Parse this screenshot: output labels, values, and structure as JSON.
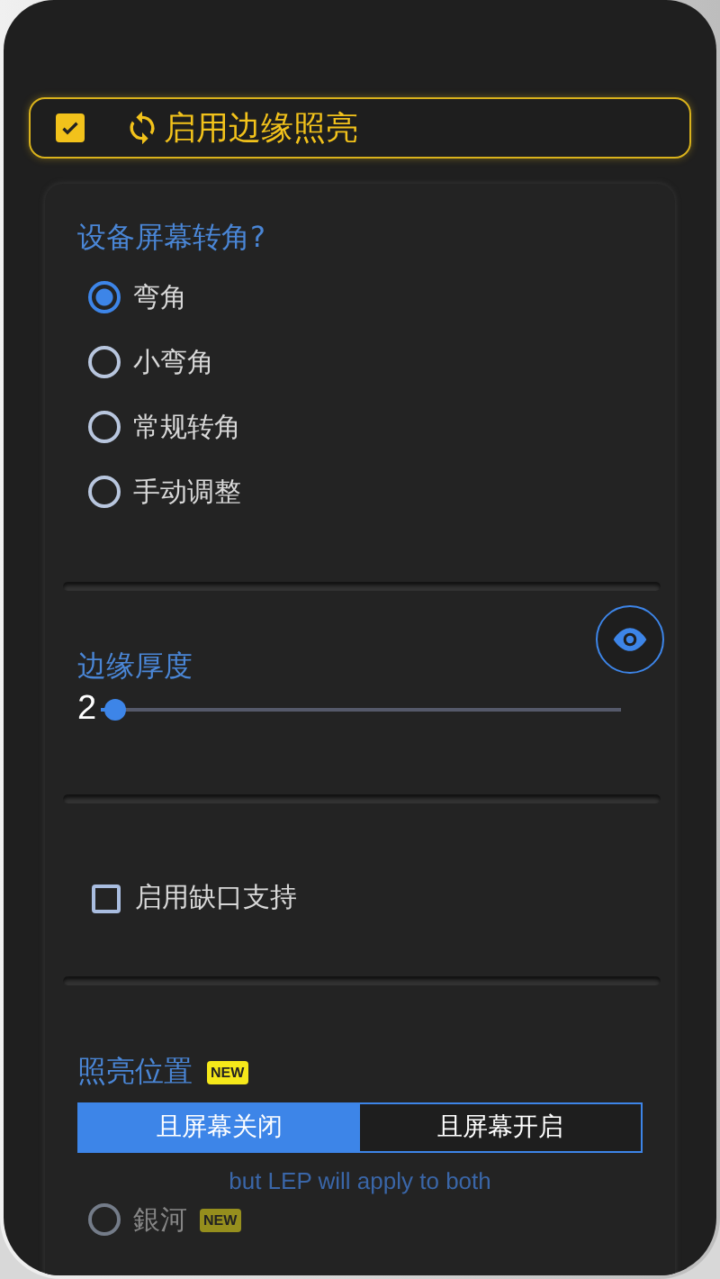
{
  "enable_toggle": {
    "label": "启用边缘照亮",
    "checked": true
  },
  "corner_section": {
    "title": "设备屏幕转角?",
    "options": [
      {
        "label": "弯角",
        "selected": true
      },
      {
        "label": "小弯角",
        "selected": false
      },
      {
        "label": "常规转角",
        "selected": false
      },
      {
        "label": "手动调整",
        "selected": false
      }
    ]
  },
  "thickness": {
    "label": "边缘厚度",
    "reading": "2",
    "level": 0.03
  },
  "notch_support": {
    "label": "启用缺口支持",
    "checked": false
  },
  "position_section": {
    "title": "照亮位置",
    "badge": "NEW",
    "segments": [
      {
        "label": "且屏幕关闭",
        "selected": true
      },
      {
        "label": "且屏幕开启",
        "selected": false
      }
    ],
    "note": "but LEP will apply to both"
  },
  "styles": [
    {
      "label": "銀河",
      "badge": "NEW",
      "selected": false,
      "disabled": true
    }
  ]
}
